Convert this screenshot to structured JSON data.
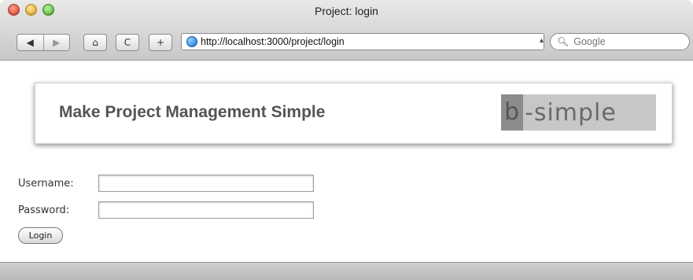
{
  "window": {
    "title": "Project: login"
  },
  "toolbar": {
    "back_icon": "◀",
    "forward_icon": "▶",
    "home_icon": "⌂",
    "reload_icon": "C",
    "add_bookmark_icon": "+",
    "url": "http://localhost:3000/project/login",
    "search_placeholder": "Google"
  },
  "banner": {
    "tagline": "Make Project Management Simple",
    "logo_first_letter": "b",
    "logo_rest": "-simple"
  },
  "form": {
    "username_label": "Username:",
    "password_label": "Password:",
    "username_value": "",
    "password_value": "",
    "login_button": "Login"
  }
}
